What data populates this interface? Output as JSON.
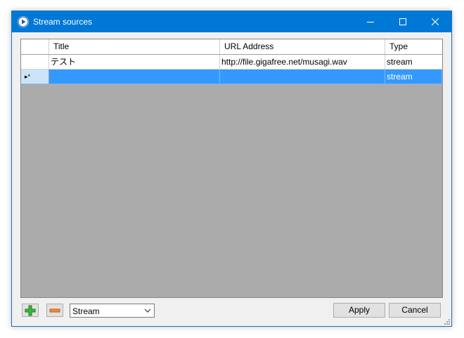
{
  "window": {
    "title": "Stream sources",
    "titlebar_color": "#0078d7"
  },
  "grid": {
    "columns": [
      "Title",
      "URL Address",
      "Type"
    ],
    "rows": [
      {
        "marker": "",
        "title": "テスト",
        "url": "http://file.gigafree.net/musagi.wav",
        "type": "stream"
      },
      {
        "marker": "▸*",
        "title": "",
        "url": "",
        "type": "stream"
      }
    ],
    "selected_row_color": "#3399ff"
  },
  "toolbar": {
    "add_icon": "plus-icon",
    "remove_icon": "minus-icon",
    "type_select_value": "Stream"
  },
  "buttons": {
    "apply": "Apply",
    "cancel": "Cancel"
  }
}
